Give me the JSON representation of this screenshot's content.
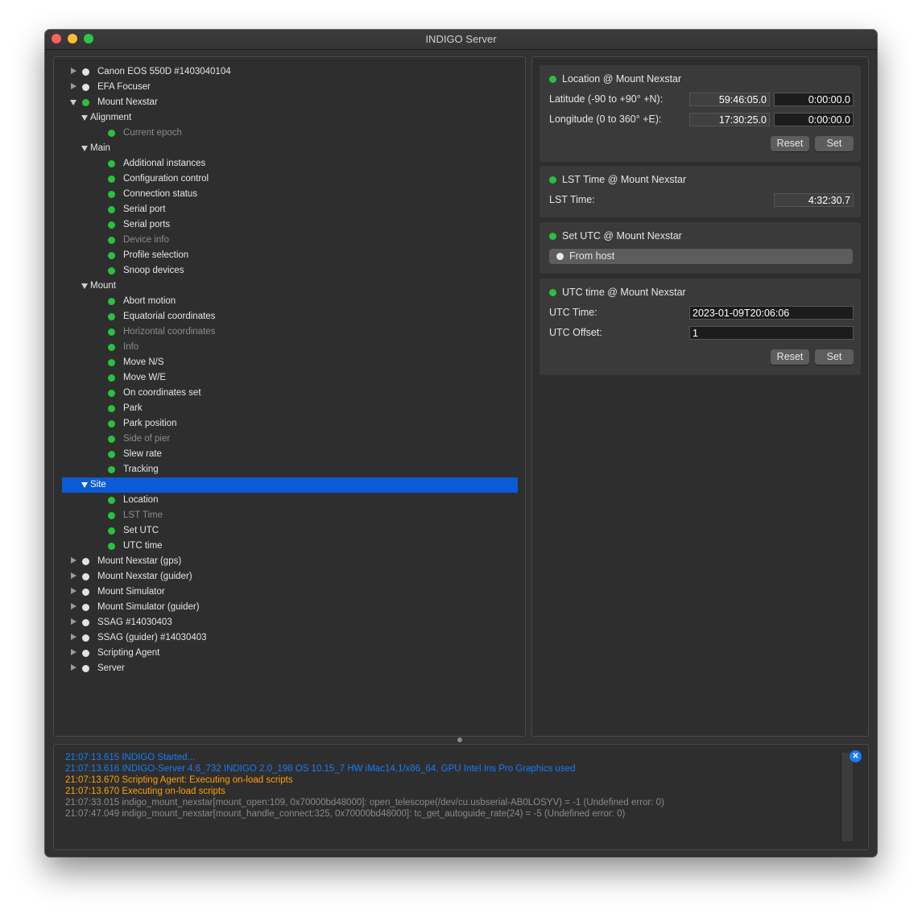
{
  "window": {
    "title": "INDIGO Server"
  },
  "colors": {
    "accent_selection": "#0b5ad6",
    "status_green": "#29c140",
    "status_idle": "#e2e2e2",
    "log_blue": "#1a7cf5",
    "log_orange": "#ff9f0a",
    "log_gray": "#8a8a8a"
  },
  "tree": [
    {
      "label": "Canon EOS 550D #1403040104",
      "kind": "device",
      "expanded": false,
      "status": "idle"
    },
    {
      "label": "EFA Focuser",
      "kind": "device",
      "expanded": false,
      "status": "idle"
    },
    {
      "label": "Mount Nexstar",
      "kind": "device",
      "expanded": true,
      "status": "ok"
    },
    {
      "label": "Alignment",
      "kind": "group"
    },
    {
      "label": "Current epoch",
      "kind": "property",
      "status": "ok",
      "dim": true
    },
    {
      "label": "Main",
      "kind": "group"
    },
    {
      "label": "Additional instances",
      "kind": "property",
      "status": "ok"
    },
    {
      "label": "Configuration control",
      "kind": "property",
      "status": "ok"
    },
    {
      "label": "Connection status",
      "kind": "property",
      "status": "ok"
    },
    {
      "label": "Serial port",
      "kind": "property",
      "status": "ok"
    },
    {
      "label": "Serial ports",
      "kind": "property",
      "status": "ok"
    },
    {
      "label": "Device info",
      "kind": "property",
      "status": "ok",
      "dim": true
    },
    {
      "label": "Profile selection",
      "kind": "property",
      "status": "ok"
    },
    {
      "label": "Snoop devices",
      "kind": "property",
      "status": "ok"
    },
    {
      "label": "Mount",
      "kind": "group"
    },
    {
      "label": "Abort motion",
      "kind": "property",
      "status": "ok"
    },
    {
      "label": "Equatorial coordinates",
      "kind": "property",
      "status": "ok"
    },
    {
      "label": "Horizontal coordinates",
      "kind": "property",
      "status": "ok",
      "dim": true
    },
    {
      "label": "Info",
      "kind": "property",
      "status": "ok",
      "dim": true
    },
    {
      "label": "Move N/S",
      "kind": "property",
      "status": "ok"
    },
    {
      "label": "Move W/E",
      "kind": "property",
      "status": "ok"
    },
    {
      "label": "On coordinates set",
      "kind": "property",
      "status": "ok"
    },
    {
      "label": "Park",
      "kind": "property",
      "status": "ok"
    },
    {
      "label": "Park position",
      "kind": "property",
      "status": "ok"
    },
    {
      "label": "Side of pier",
      "kind": "property",
      "status": "ok",
      "dim": true
    },
    {
      "label": "Slew rate",
      "kind": "property",
      "status": "ok"
    },
    {
      "label": "Tracking",
      "kind": "property",
      "status": "ok"
    },
    {
      "label": "Site",
      "kind": "group",
      "selected": true
    },
    {
      "label": "Location",
      "kind": "property",
      "status": "ok"
    },
    {
      "label": "LST Time",
      "kind": "property",
      "status": "ok",
      "dim": true
    },
    {
      "label": "Set UTC",
      "kind": "property",
      "status": "ok"
    },
    {
      "label": "UTC time",
      "kind": "property",
      "status": "ok"
    },
    {
      "label": "Mount Nexstar (gps)",
      "kind": "device",
      "expanded": false,
      "status": "idle"
    },
    {
      "label": "Mount Nexstar (guider)",
      "kind": "device",
      "expanded": false,
      "status": "idle"
    },
    {
      "label": "Mount Simulator",
      "kind": "device",
      "expanded": false,
      "status": "idle"
    },
    {
      "label": "Mount Simulator (guider)",
      "kind": "device",
      "expanded": false,
      "status": "idle"
    },
    {
      "label": "SSAG #14030403",
      "kind": "device",
      "expanded": false,
      "status": "idle"
    },
    {
      "label": "SSAG (guider) #14030403",
      "kind": "device",
      "expanded": false,
      "status": "idle"
    },
    {
      "label": "Scripting Agent",
      "kind": "device",
      "expanded": false,
      "status": "idle"
    },
    {
      "label": "Server",
      "kind": "device",
      "expanded": false,
      "status": "idle"
    }
  ],
  "properties": {
    "location": {
      "title": "Location @ Mount Nexstar",
      "latitude_label": "Latitude (-90 to +90° +N):",
      "latitude_value": "59:46:05.0",
      "latitude_input": "0:00:00.0",
      "longitude_label": "Longitude (0 to 360° +E):",
      "longitude_value": "17:30:25.0",
      "longitude_input": "0:00:00.0",
      "reset_label": "Reset",
      "set_label": "Set"
    },
    "lst": {
      "title": "LST Time @ Mount Nexstar",
      "label": "LST Time:",
      "value": "4:32:30.7"
    },
    "set_utc": {
      "title": "Set UTC @ Mount Nexstar",
      "option_label": "From host"
    },
    "utc": {
      "title": "UTC time @ Mount Nexstar",
      "time_label": "UTC Time:",
      "time_value": "2023-01-09T20:06:06",
      "offset_label": "UTC Offset:",
      "offset_value": "1",
      "reset_label": "Reset",
      "set_label": "Set"
    }
  },
  "log": [
    {
      "text": "21:07:13.615 INDIGO Started...",
      "color": "#1a7cf5"
    },
    {
      "text": "21:07:13.616 INDIGO-Server 4.6_732 INDIGO 2.0_198 OS 10.15_7 HW iMac14,1/x86_64, GPU Intel Iris Pro Graphics used",
      "color": "#1a7cf5"
    },
    {
      "text": "21:07:13.670 Scripting Agent: Executing on-load scripts",
      "color": "#ff9f0a"
    },
    {
      "text": "21:07:13.670 Executing on-load scripts",
      "color": "#ff9f0a"
    },
    {
      "text": "21:07:33.015 indigo_mount_nexstar[mount_open:109, 0x70000bd48000]: open_telescope(/dev/cu.usbserial-AB0LOSYV) = -1 (Undefined error: 0)",
      "color": "#8a8a8a"
    },
    {
      "text": "21:07:47.049 indigo_mount_nexstar[mount_handle_connect:325, 0x70000bd48000]: tc_get_autoguide_rate(24) = -5 (Undefined error: 0)",
      "color": "#8a8a8a"
    }
  ]
}
